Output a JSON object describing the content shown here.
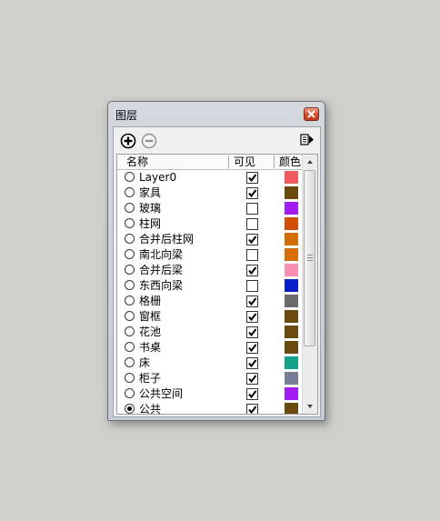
{
  "window": {
    "title": "图层",
    "close_icon": "close-icon"
  },
  "toolbar": {
    "add_icon": "add-layer-icon",
    "remove_icon": "remove-layer-icon",
    "details_icon": "details-flyout-icon"
  },
  "columns": {
    "name": "名称",
    "visible": "可见",
    "color": "颜色"
  },
  "layers": [
    {
      "name": "Layer0",
      "active": false,
      "visible": true,
      "color": "#f25b5b"
    },
    {
      "name": "家具",
      "active": false,
      "visible": true,
      "color": "#6b4a0f"
    },
    {
      "name": "玻璃",
      "active": false,
      "visible": false,
      "color": "#a21ef0"
    },
    {
      "name": "柱网",
      "active": false,
      "visible": false,
      "color": "#d24d06"
    },
    {
      "name": "合并后柱网",
      "active": false,
      "visible": true,
      "color": "#d26d08"
    },
    {
      "name": "南北向梁",
      "active": false,
      "visible": false,
      "color": "#d56f05"
    },
    {
      "name": "合并后梁",
      "active": false,
      "visible": true,
      "color": "#f78fb3"
    },
    {
      "name": "东西向梁",
      "active": false,
      "visible": false,
      "color": "#0a1ec8"
    },
    {
      "name": "格栅",
      "active": false,
      "visible": true,
      "color": "#6b6b6b"
    },
    {
      "name": "窗框",
      "active": false,
      "visible": true,
      "color": "#6b4a0f"
    },
    {
      "name": "花池",
      "active": false,
      "visible": true,
      "color": "#6b4a0f"
    },
    {
      "name": "书桌",
      "active": false,
      "visible": true,
      "color": "#6b4a0f"
    },
    {
      "name": "床",
      "active": false,
      "visible": true,
      "color": "#12a08a"
    },
    {
      "name": "柜子",
      "active": false,
      "visible": true,
      "color": "#7a7d9a"
    },
    {
      "name": "公共空间",
      "active": false,
      "visible": true,
      "color": "#a21ef0"
    },
    {
      "name": "公共",
      "active": true,
      "visible": true,
      "color": "#6b4a0f"
    }
  ],
  "scrollbar": {
    "up_icon": "scroll-up-arrow-icon",
    "down_icon": "scroll-down-arrow-icon"
  }
}
